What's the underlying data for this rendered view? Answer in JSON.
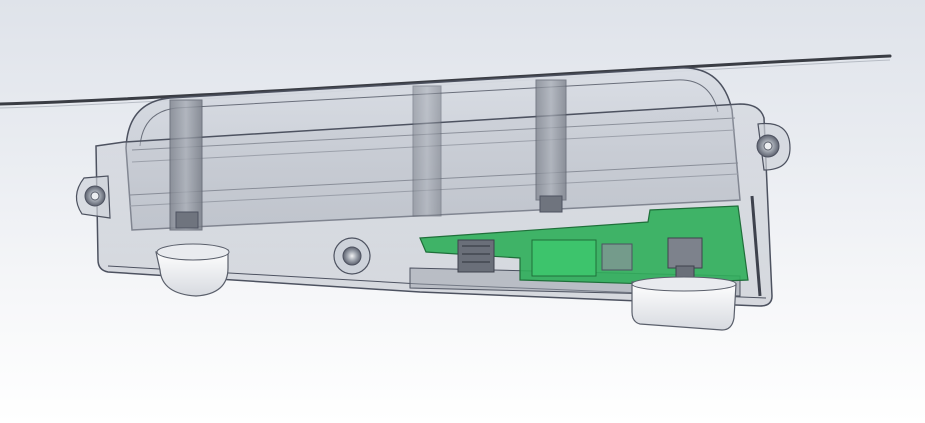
{
  "app": {
    "view": "3d-model-viewport"
  },
  "model": {
    "colors": {
      "background_top": "#dfe3ea",
      "background_bottom": "#ffffff",
      "enclosure_fill": "#c9ced7",
      "enclosure_edge": "#4d5260",
      "pcb_green": "#2fae5a",
      "standoff_gray": "#8d929c",
      "wire": "#3a3d44",
      "foot_white": "#f4f5f7"
    },
    "components": [
      "cable-wire",
      "enclosure-lid",
      "enclosure-base",
      "mounting-tab-left",
      "mounting-tab-right",
      "standoffs",
      "pcb-board",
      "rubber-feet"
    ]
  }
}
